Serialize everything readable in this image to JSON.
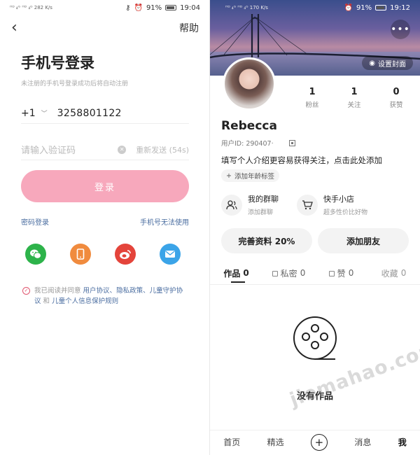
{
  "left": {
    "status": {
      "left": "ᴴᴰ ₄ᴳ ᴴᴰ ₄ᴳ 282 K/s",
      "time": "19:04",
      "battery": "91%"
    },
    "help": "帮助",
    "title": "手机号登录",
    "subtitle": "未注册的手机号登录成功后将自动注册",
    "country_code": "+1",
    "phone": "3258801122",
    "code_placeholder": "请输入验证码",
    "resend": "重新发送 (54s)",
    "login_button": "登录",
    "password_login": "密码登录",
    "phone_unavailable": "手机号无法使用",
    "agreement": {
      "prefix": "我已阅读并同意 ",
      "user_agreement": "用户协议",
      "sep1": "、",
      "privacy": "隐私政策",
      "sep2": "、",
      "child": "儿童守护协议",
      "and": " 和 ",
      "child_info": "儿童个人信息保护规则"
    },
    "colors": {
      "wechat": "#2db34a",
      "phone": "#f08b3e",
      "weibo": "#e4443b",
      "mail": "#3ba4e8"
    }
  },
  "right": {
    "status": {
      "left": "ᴴᴰ ₄ᴳ ᴴᴰ ₄ᴳ 170 K/s",
      "time": "19:12",
      "battery": "91%"
    },
    "more": "•••",
    "set_cover": "设置封面",
    "stats": [
      {
        "n": "1",
        "l": "粉丝"
      },
      {
        "n": "1",
        "l": "关注"
      },
      {
        "n": "0",
        "l": "获赞"
      }
    ],
    "username": "Rebecca",
    "user_id": "用户ID: 290407·",
    "bio": "填写个人介绍更容易获得关注，点击此处添加",
    "age_tag": "添加年龄标签",
    "group_chat": {
      "title": "我的群聊",
      "sub": "添加群聊"
    },
    "shop": {
      "title": "快手小店",
      "sub": "超多性价比好物"
    },
    "complete_profile": "完善资料 20%",
    "add_friend": "添加朋友",
    "tabs": [
      {
        "label": "作品",
        "count": "0"
      },
      {
        "label": "私密",
        "count": "0"
      },
      {
        "label": "赞",
        "count": "0"
      },
      {
        "label": "收藏",
        "count": "0"
      }
    ],
    "empty": "没有作品",
    "nav": {
      "home": "首页",
      "featured": "精选",
      "messages": "消息",
      "me": "我"
    }
  },
  "watermark": "jiemahao.com"
}
